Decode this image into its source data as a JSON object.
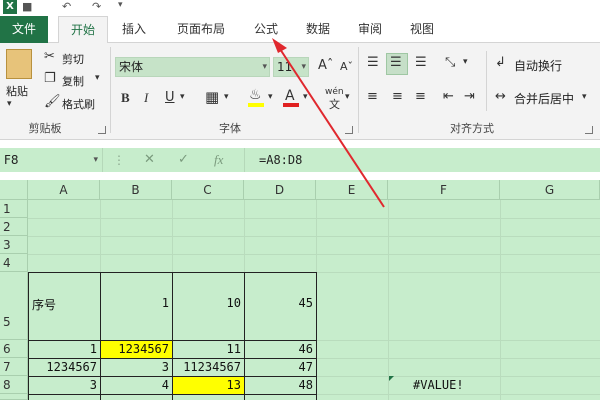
{
  "app": {
    "logo": "X"
  },
  "tabs": [
    "文件",
    "开始",
    "插入",
    "页面布局",
    "公式",
    "数据",
    "审阅",
    "视图"
  ],
  "ribbon": {
    "clipboard": {
      "paste": "粘贴",
      "cut": "剪切",
      "copy": "复制",
      "format_painter": "格式刷",
      "label": "剪贴板"
    },
    "font": {
      "name": "宋体",
      "size": "11",
      "bold": "B",
      "italic": "I",
      "underline": "U",
      "wen": "wén",
      "label": "字体"
    },
    "alignment": {
      "wrap": "自动换行",
      "merge": "合并后居中",
      "label": "对齐方式"
    }
  },
  "formula_bar": {
    "name_box": "F8",
    "fx": "fx",
    "formula": "=A8:D8"
  },
  "columns": [
    "A",
    "B",
    "C",
    "D",
    "E",
    "F",
    "G"
  ],
  "rows": [
    "1",
    "2",
    "3",
    "4",
    "5",
    "6",
    "7",
    "8"
  ],
  "cells": {
    "A5": "序号",
    "B5": "1",
    "C5": "10",
    "D5": "45",
    "A6": "1",
    "B6": "1234567",
    "C6": "11",
    "D6": "46",
    "A7": "1234567",
    "B7": "3",
    "C7": "11234567",
    "D7": "47",
    "A8": "3",
    "B8": "4",
    "C8": "13",
    "D8": "48",
    "F8": "#VALUE!"
  },
  "colors": {
    "excel_green": "#217346",
    "sheet_bg": "#c7edcc",
    "highlight": "#ffff00"
  }
}
